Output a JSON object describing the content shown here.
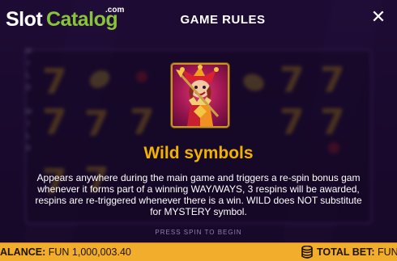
{
  "brand": {
    "logo_slot": "Slot",
    "logo_catalog": "Catalog",
    "logo_com": ".com"
  },
  "header": {
    "title": "GAME RULES",
    "close_icon": "close-icon"
  },
  "section": {
    "heading": "Wild symbols",
    "lines": [
      "Appears anywhere during the main game and triggers a re-spin bonus gam",
      "whenever it forms part of a winning WAY/WAYS, 3 respins will be awarded,",
      "respins are re-triggered whenever there is a win. WILD does NOT substitute",
      "for MYSTERY symbol."
    ],
    "symbol_icon": "wild-jester-icon"
  },
  "background": {
    "reel_word": "WILD",
    "press_text": "PRESS SPIN TO BEGIN"
  },
  "footer": {
    "balance_label": "ALANCE:",
    "balance_value": "FUN 1,000,003.40",
    "bet_label": "TOTAL BET:",
    "bet_value": "FUN",
    "coin_icon": "coin-stack-icon"
  },
  "colors": {
    "accent": "#f2b300",
    "footer": "#f2ad2c",
    "brand_green": "#88c43a",
    "background": "#2b1248"
  }
}
